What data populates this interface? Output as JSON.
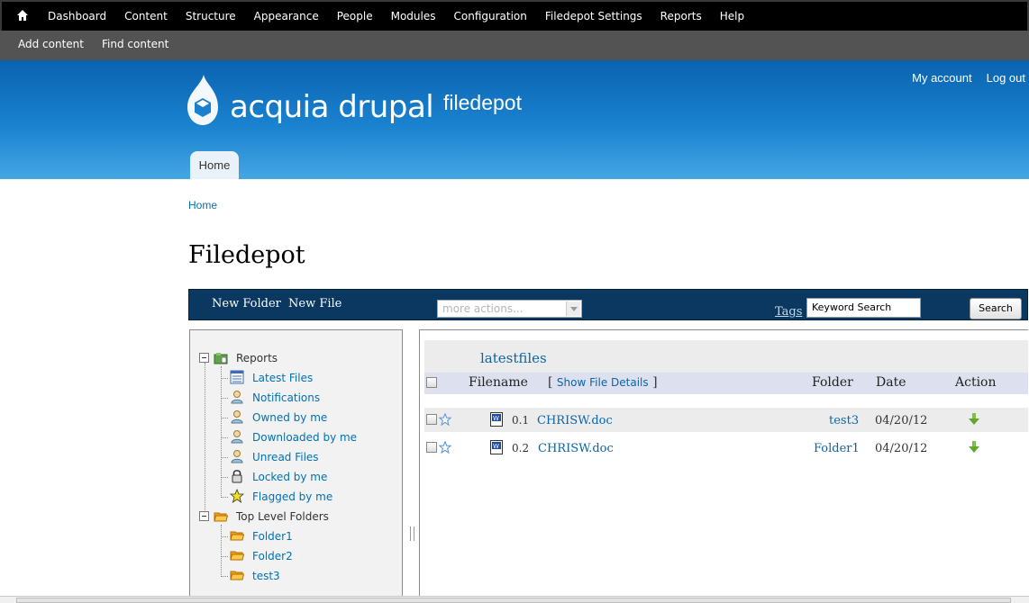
{
  "toolbar": {
    "menu": [
      "Dashboard",
      "Content",
      "Structure",
      "Appearance",
      "People",
      "Modules",
      "Configuration",
      "Filedepot Settings",
      "Reports",
      "Help"
    ],
    "shortcuts": [
      "Add content",
      "Find content"
    ]
  },
  "header": {
    "logo_text": "acquia drupal",
    "site_name": "filedepot",
    "secondary_menu": [
      "My account",
      "Log out"
    ],
    "tab_home": "Home"
  },
  "breadcrumb": "Home",
  "page_title": "Filedepot",
  "fd_bar": {
    "new_folder": "New Folder",
    "new_file": "New File",
    "more_actions": "more actions...",
    "tags": "Tags",
    "keyword_search": "Keyword Search",
    "search_button": "Search"
  },
  "tree": {
    "reports_label": "Reports",
    "reports": [
      {
        "label": "Latest Files",
        "icon": "list-icon"
      },
      {
        "label": "Notifications",
        "icon": "user-icon"
      },
      {
        "label": "Owned by me",
        "icon": "user-icon"
      },
      {
        "label": "Downloaded by me",
        "icon": "user-icon"
      },
      {
        "label": "Unread Files",
        "icon": "user-icon"
      },
      {
        "label": "Locked by me",
        "icon": "lock-icon"
      },
      {
        "label": "Flagged by me",
        "icon": "star-icon"
      }
    ],
    "folders_label": "Top Level Folders",
    "folders": [
      "Folder1",
      "Folder2",
      "test3"
    ]
  },
  "files": {
    "title": "latestfiles",
    "headers": {
      "filename": "Filename",
      "show_details_open": "[",
      "show_details": "Show File Details",
      "show_details_close": "]",
      "folder": "Folder",
      "date": "Date",
      "action": "Action"
    },
    "rows": [
      {
        "num": "0.1",
        "name": "CHRISW.doc",
        "folder": "test3",
        "date": "04/20/12"
      },
      {
        "num": "0.2",
        "name": "CHRISW.doc",
        "folder": "Folder1",
        "date": "04/20/12"
      }
    ]
  },
  "colors": {
    "toolbar": "#000000",
    "shortcuts": "#535353",
    "header_top": "#0a63b0",
    "header_bottom": "#46a6e3",
    "fd_bar": "#0b3861",
    "link": "#0071b3"
  }
}
